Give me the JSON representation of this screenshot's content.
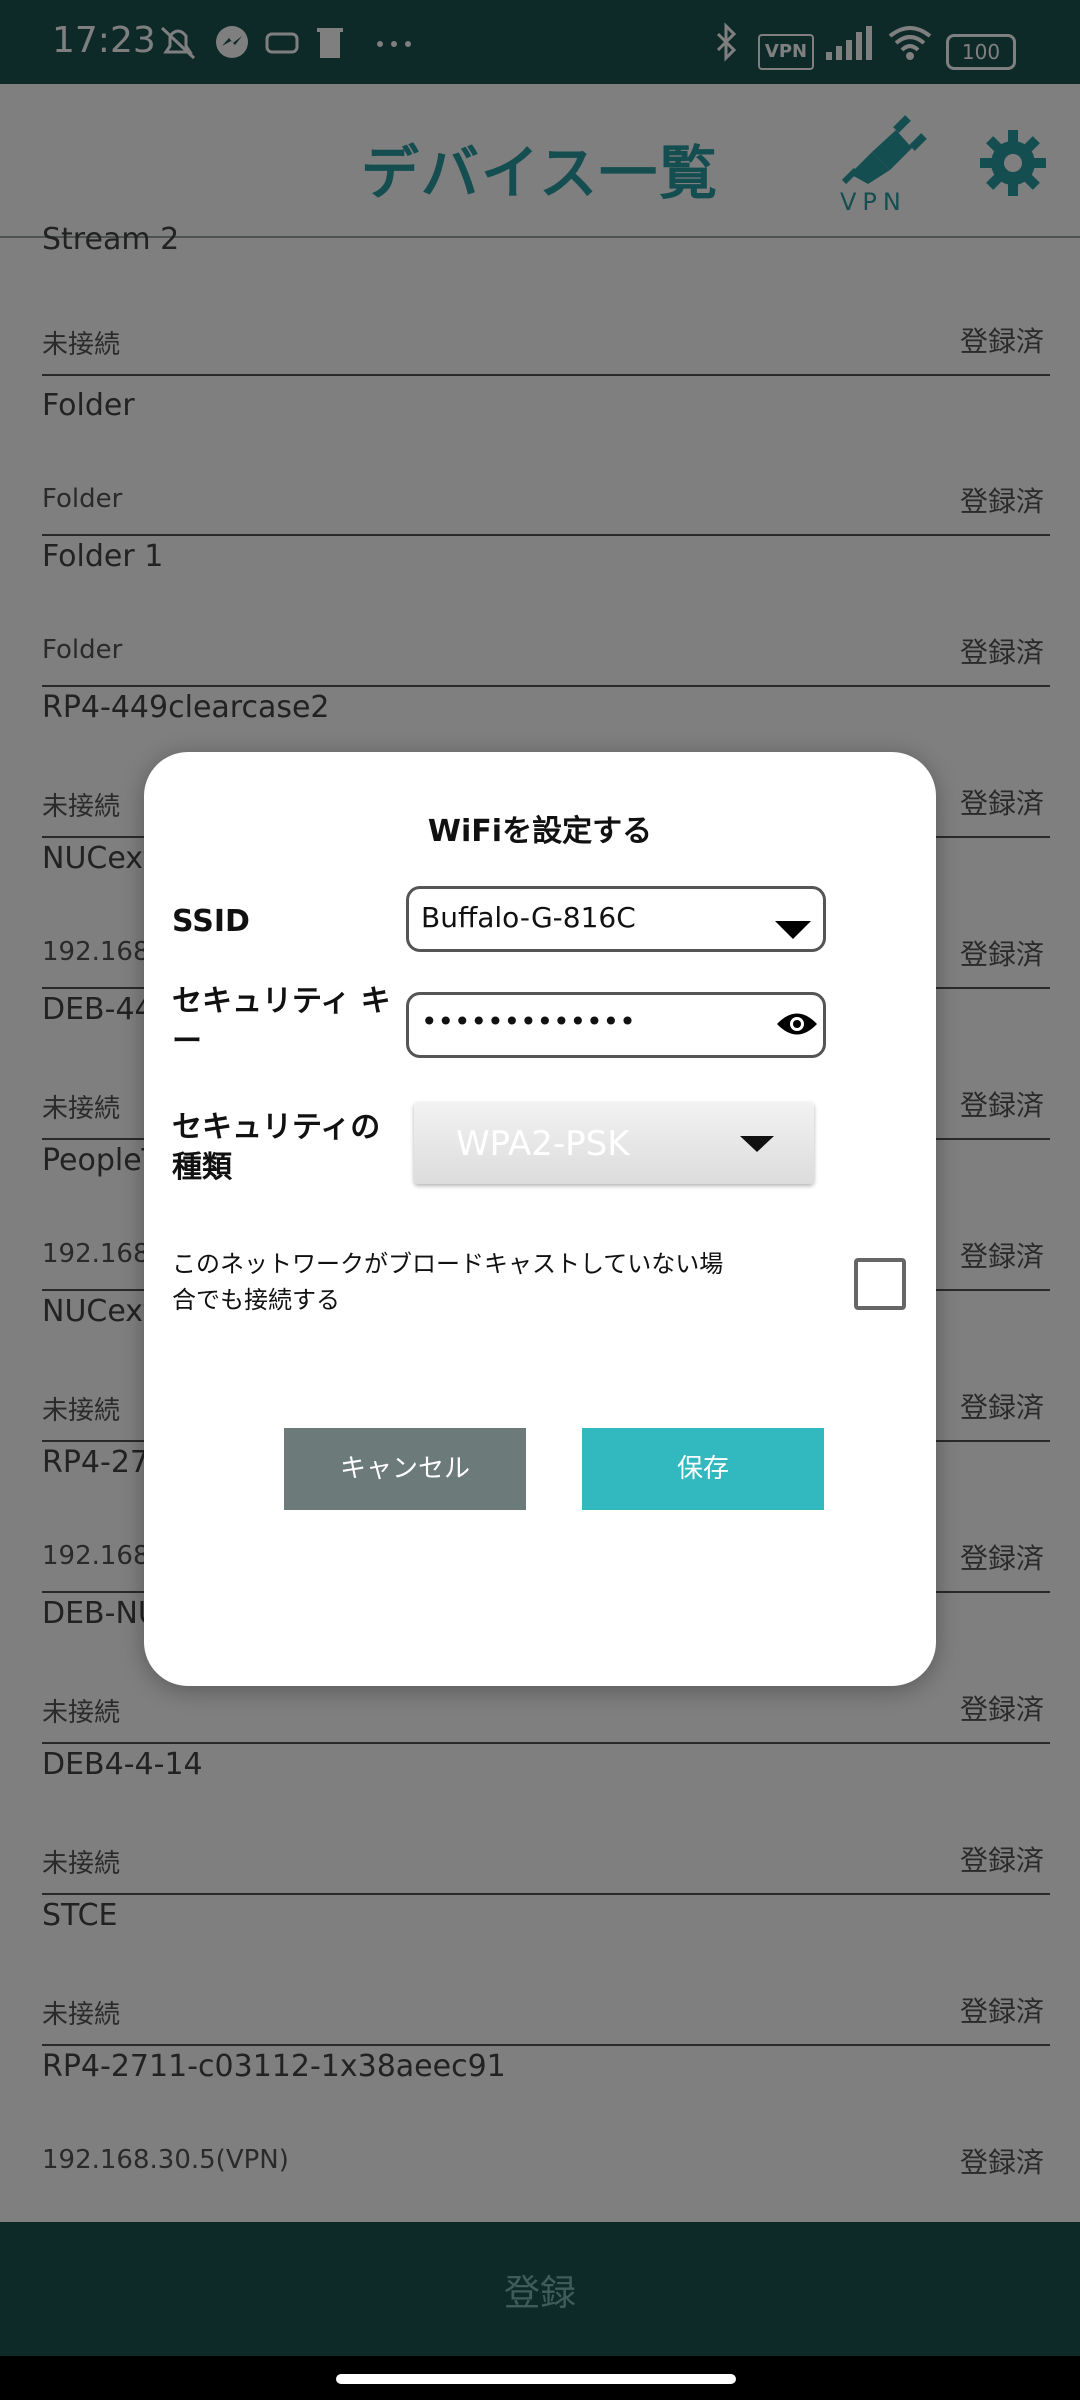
{
  "status_bar": {
    "time": "17:23",
    "battery": "100",
    "vpn": "VPN"
  },
  "app_bar": {
    "title": "デバイス一覧",
    "vpn_label": "VPN"
  },
  "devices": [
    {
      "name": "Stream 2",
      "status": "未接続",
      "registered": "登録済"
    },
    {
      "name": "Folder",
      "status": "Folder",
      "registered": "登録済"
    },
    {
      "name": "Folder 1",
      "status": "Folder",
      "registered": "登録済"
    },
    {
      "name": "RP4-449clearcase2",
      "status": "未接続",
      "registered": "登録済"
    },
    {
      "name": "NUCext",
      "status": "192.168.",
      "registered": "登録済"
    },
    {
      "name": "DEB-44",
      "status": "未接続",
      "registered": "登録済"
    },
    {
      "name": "PeopleT",
      "status": "192.168.",
      "registered": "登録済"
    },
    {
      "name": "NUCext",
      "status": "未接続",
      "registered": "登録済"
    },
    {
      "name": "RP4-27",
      "status": "192.168.",
      "registered": "登録済"
    },
    {
      "name": "DEB-NU",
      "status": "未接続",
      "registered": "登録済"
    },
    {
      "name": "DEB4-4-14",
      "status": "未接続",
      "registered": "登録済"
    },
    {
      "name": "STCE",
      "status": "未接続",
      "registered": "登録済"
    },
    {
      "name": "RP4-2711-c03112-1x38aeec91",
      "status": "192.168.30.5(VPN)",
      "registered": "登録済"
    }
  ],
  "bottom_bar": {
    "label": "登録"
  },
  "dialog": {
    "title": "WiFiを設定する",
    "ssid_label": "SSID",
    "ssid_value": "Buffalo-G-816C",
    "key_label": "セキュリティ キー",
    "key_value": "•••••••••••••",
    "security_type_label": "セキュリティの種類",
    "security_type_value": "WPA2-PSK",
    "hidden_network_label": "このネットワークがブロードキャストしていない場合でも接続する",
    "cancel_label": "キャンセル",
    "save_label": "保存"
  },
  "colors": {
    "primary_dark": "#1b5553",
    "accent": "#2a9da1",
    "save": "#31b9bf",
    "cancel": "#6d7a7a"
  }
}
